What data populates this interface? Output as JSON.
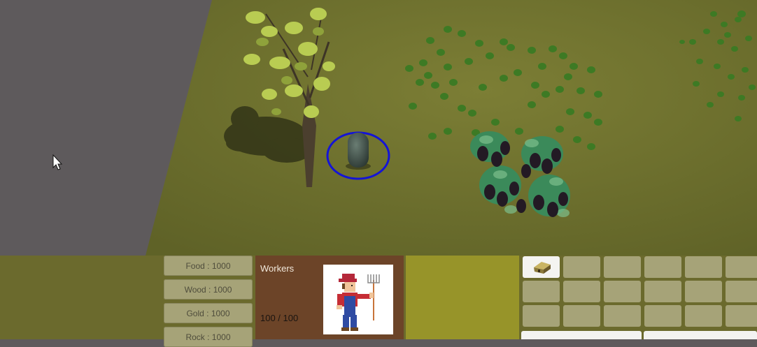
{
  "resources": [
    {
      "label": "Food : 1000"
    },
    {
      "label": "Wood : 1000"
    },
    {
      "label": "Gold : 1000"
    },
    {
      "label": "Rock : 1000"
    }
  ],
  "selected_unit": {
    "name": "Workers",
    "health": "100 / 100",
    "portrait_icon": "farmer-with-pitchfork-icon"
  },
  "build_menu": {
    "first_slot_icon": "house-icon"
  },
  "colors": {
    "grass": "#6f722f",
    "ground_void": "#5e5a5c",
    "selection_ring": "#1414d6",
    "hud_background": "#6b6a2d",
    "unit_panel": "#6c4428",
    "info_panel": "#979429",
    "button": "#a6a378"
  }
}
